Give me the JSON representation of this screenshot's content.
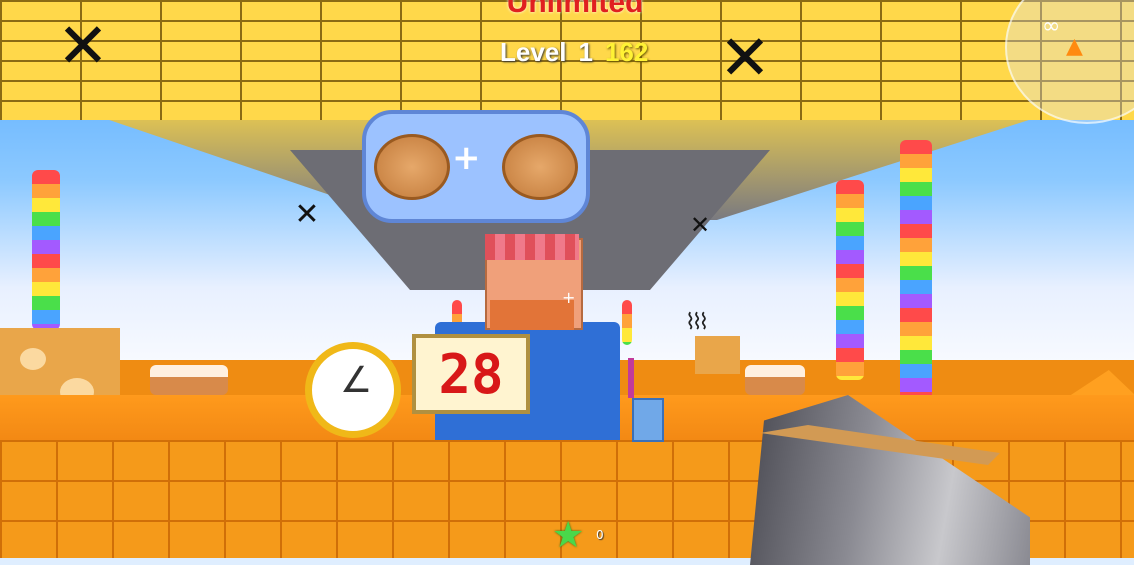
{
  "hud": {
    "mode_text": "Unlimited",
    "level_label": "Level",
    "level_number": "1",
    "score": "162",
    "star_count": "0"
  },
  "scene": {
    "timer_display": "28",
    "order_items": [
      "cookie",
      "cookie"
    ],
    "order_operator": "+"
  },
  "icons": {
    "ceiling_sign": "fork-knife-icon",
    "clock": "alarm-clock-icon",
    "minimap_player": "player-arrow-icon",
    "minimap_goggles": "goggles-icon",
    "hotbar_star": "star-icon"
  },
  "colors": {
    "mode_text": "#e02020",
    "score": "#fff235",
    "timer_digits": "#d81818",
    "ceiling": "#ffd84a",
    "floor": "#ef8c12",
    "star": "#4ad84a"
  }
}
